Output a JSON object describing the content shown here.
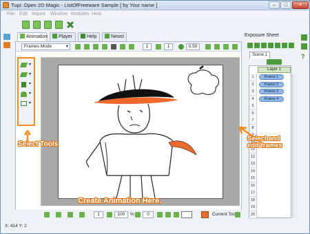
{
  "window": {
    "title": "Tupi: Open 2D Magic - ListOfFreeware Sample [ by Your name ]"
  },
  "menu": [
    "File",
    "Edit",
    "Import",
    "Window",
    "Modules",
    "Help"
  ],
  "tabs": [
    {
      "label": "Animation",
      "icon": "film-icon"
    },
    {
      "label": "Player",
      "icon": "play-icon"
    },
    {
      "label": "Help",
      "icon": "help-icon"
    },
    {
      "label": "News!",
      "icon": "news-icon"
    }
  ],
  "canvas_toolbar": {
    "mode": "Frames Mode",
    "frame_spin": "1",
    "onion_spin": "1",
    "opacity": "0.50"
  },
  "bottom_toolbar": {
    "frame": "1",
    "zoom": "100",
    "zoom_unit": "%",
    "rotation": "0"
  },
  "status": {
    "coords": "X: 414 Y: 2",
    "current_tool": "Current Tool"
  },
  "exposure_sheet": {
    "title": "Exposure Sheet",
    "scene_tab": "Scene 1",
    "layer": "Layer 1",
    "frames": [
      "Frame 1",
      "Frame 2",
      "Frame 3",
      "Frame 4"
    ],
    "row_numbers": [
      "1",
      "2",
      "3",
      "4",
      "5",
      "6",
      "7",
      "8",
      "9",
      "10",
      "11",
      "12",
      "13",
      "14",
      "15",
      "16",
      "17",
      "18",
      "19",
      "20"
    ]
  },
  "annotations": {
    "select_tools": "Select Tools",
    "select_edit_frames": "Select and edit frames",
    "create_animation": "Create Animation Here."
  },
  "colors": {
    "accent": "#f28c1e",
    "frame_cell": "#8fb7e8",
    "hat_orange": "#ef6a2a"
  }
}
